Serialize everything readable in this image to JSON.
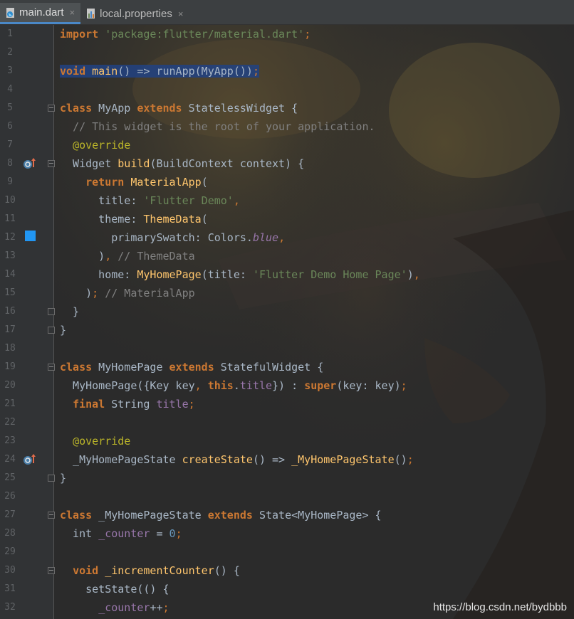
{
  "tabs": [
    {
      "label": "main.dart",
      "active": true,
      "icon": "dart-file-icon"
    },
    {
      "label": "local.properties",
      "active": false,
      "icon": "properties-file-icon"
    }
  ],
  "close_glyph": "×",
  "line_numbers": [
    "1",
    "2",
    "3",
    "4",
    "5",
    "6",
    "7",
    "8",
    "9",
    "10",
    "11",
    "12",
    "13",
    "14",
    "15",
    "16",
    "17",
    "18",
    "19",
    "20",
    "21",
    "22",
    "23",
    "24",
    "25",
    "26",
    "27",
    "28",
    "29",
    "30",
    "31",
    "32"
  ],
  "watermark": "https://blog.csdn.net/bydbbb",
  "colors": {
    "keyword": "#cc7832",
    "string": "#6a8759",
    "comment": "#808080",
    "annotation": "#bbb529",
    "function": "#ffc66d",
    "field": "#9876aa",
    "number": "#6897bb",
    "text": "#a9b7c6",
    "color_swatch": "#2196f3"
  }
}
